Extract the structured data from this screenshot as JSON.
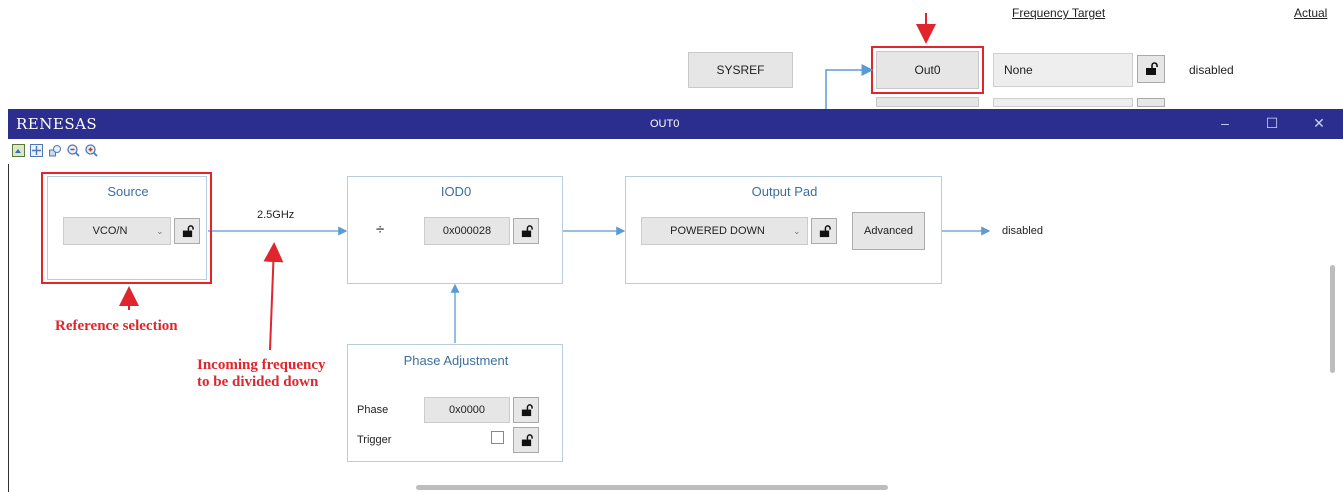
{
  "background": {
    "col_frequency_target": "Frequency Target",
    "col_actual": "Actual",
    "sysref_button": "SYSREF",
    "out0_button": "Out0",
    "frequency_value": "None",
    "actual_value": "disabled"
  },
  "window": {
    "logo": "RENESAS",
    "title": "OUT0",
    "controls": [
      "–",
      "☐",
      "✕"
    ]
  },
  "source": {
    "title": "Source",
    "selected": "VCO/N"
  },
  "link_frequency": "2.5GHz",
  "iod": {
    "title": "IOD0",
    "divide_symbol": "÷",
    "value": "0x000028"
  },
  "output_pad": {
    "title": "Output Pad",
    "selected": "POWERED DOWN",
    "advanced_button": "Advanced",
    "status": "disabled"
  },
  "phase": {
    "title": "Phase Adjustment",
    "phase_label": "Phase",
    "phase_value": "0x0000",
    "trigger_label": "Trigger",
    "trigger_checked": false
  },
  "annotations": {
    "reference": "Reference selection",
    "incoming_line1": "Incoming frequency",
    "incoming_line2": "to be divided down"
  },
  "colors": {
    "titlebar": "#2b2e8f",
    "annotation_red": "#e0262c",
    "block_border": "#b8cde0",
    "arrow_blue": "#5b9bd5"
  }
}
